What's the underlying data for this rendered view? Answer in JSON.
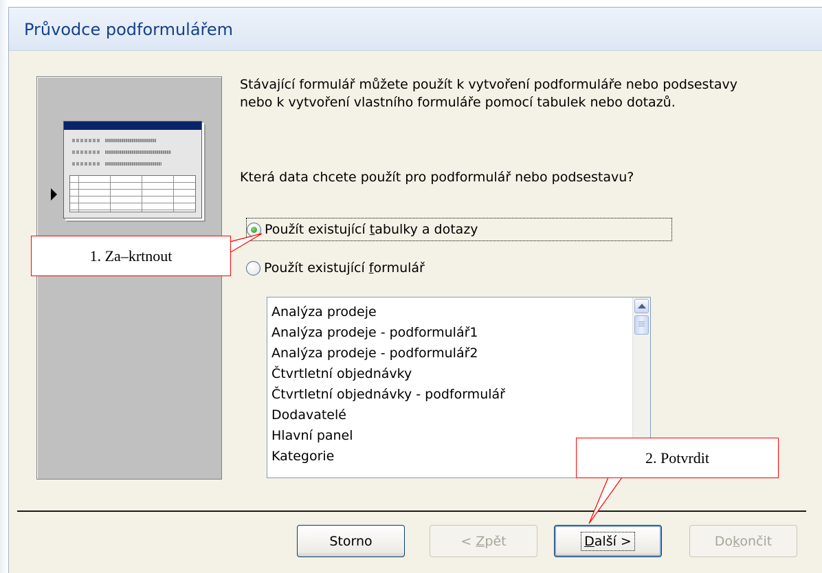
{
  "dialog": {
    "title": "Průvodce podformulářem",
    "description": "Stávající formulář můžete použít k vytvoření podformuláře nebo podsestavy\nnebo k vytvoření vlastního formuláře pomocí tabulek nebo dotazů.",
    "question": "Která data chcete použít pro podformulář nebo podsestavu?"
  },
  "options": {
    "use_tables": {
      "pre": "Použít existující ",
      "accel": "t",
      "post": "abulky a dotazy",
      "checked": true
    },
    "use_form": {
      "pre": "Použít existující ",
      "accel": "f",
      "post": "ormulář",
      "checked": false
    }
  },
  "form_list": {
    "items": [
      "Analýza prodeje",
      "Analýza prodeje - podformulář1",
      "Analýza prodeje - podformulář2",
      "Čtvrtletní objednávky",
      "Čtvrtletní objednávky - podformulář",
      "Dodavatelé",
      "Hlavní panel",
      "Kategorie"
    ]
  },
  "buttons": {
    "cancel": "Storno",
    "back": {
      "pre": "< ",
      "accel": "Z",
      "post": "pět"
    },
    "next": {
      "pre": "",
      "accel": "D",
      "post": "alší >"
    },
    "finish": {
      "pre": "Do",
      "accel": "k",
      "post": "ončit"
    }
  },
  "callouts": {
    "step1": "1.   Za–krtnout",
    "step2": "2.   Potvrdit"
  },
  "colors": {
    "callout_border": "#ff0000",
    "title_text": "#15428b",
    "dialog_bg": "#f4f2e6"
  },
  "icons": {
    "wizard_illustration": "form-preview-icon",
    "scroll_up": "chevron-up-icon"
  }
}
